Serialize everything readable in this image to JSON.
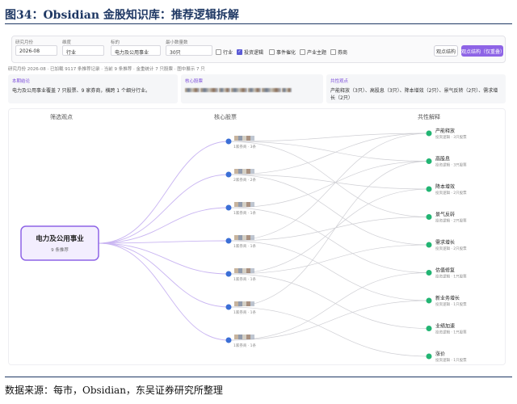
{
  "figure": {
    "title": "图34：Obsidian 金股知识库：推荐逻辑拆解",
    "source": "数据来源：每市，Obsidian，东吴证券研究所整理"
  },
  "filters": {
    "month": {
      "label": "研究月份",
      "value": "2026-08"
    },
    "dimension": {
      "label": "维度",
      "value": "行业"
    },
    "target": {
      "label": "标的",
      "value": "电力及公用事业"
    },
    "min_count": {
      "label": "最小数量数",
      "value": "30只"
    },
    "checkboxes": [
      {
        "label": "行业",
        "checked": false
      },
      {
        "label": "投资逻辑",
        "checked": true
      },
      {
        "label": "事件催化",
        "checked": false
      },
      {
        "label": "产业主题",
        "checked": false
      },
      {
        "label": "券商",
        "checked": false
      }
    ],
    "buttons": {
      "structure": "观点结构",
      "structure_grouped": "观点结构（仅重叠）"
    }
  },
  "stats_text": "研究月份 2026-08 · 已加载 9117 条推荐记录 · 当前 9 条推荐 · 金重统计 7 只股票 · 图中展示 7 只",
  "cards": {
    "conclusion": {
      "title": "本期结论",
      "body": "电力及公用事业覆盖 7 只股票、9 家券商，横跨 1 个细分行业。"
    },
    "core": {
      "title": "核心股票"
    },
    "common": {
      "title": "共性观点",
      "body": "产能释放（3只）、高股息（3只）、降本增效（2只）、景气反转（2只）、需求增长（2只）"
    }
  },
  "graph": {
    "col_headers": [
      "筛选观点",
      "核心股票",
      "共性解释"
    ],
    "root": {
      "label": "电力及公用事业",
      "sub": "9 条推荐"
    },
    "stocks": [
      {
        "sub": "1家券商 · 3条"
      },
      {
        "sub": "2家券商 · 2条"
      },
      {
        "sub": "1家券商 · 1条"
      },
      {
        "sub": "1家券商 · 1条"
      },
      {
        "sub": "1家券商 · 1条"
      },
      {
        "sub": "1家券商 · 1条"
      },
      {
        "sub": "1家券商 · 1条"
      }
    ],
    "themes": [
      {
        "name": "产能释放",
        "sub": "投资逻辑 · 3只股票"
      },
      {
        "name": "高股息",
        "sub": "投资逻辑 · 3只股票"
      },
      {
        "name": "降本增效",
        "sub": "投资逻辑 · 2只股票"
      },
      {
        "name": "景气反转",
        "sub": "投资逻辑 · 2只股票"
      },
      {
        "name": "需求增长",
        "sub": "投资逻辑 · 2只股票"
      },
      {
        "name": "估值修复",
        "sub": "投资逻辑 · 1只股票"
      },
      {
        "name": "新业务增长",
        "sub": "投资逻辑 · 1只股票"
      },
      {
        "name": "业绩加速",
        "sub": "投资逻辑 · 1只股票"
      },
      {
        "name": "涨价",
        "sub": "投资逻辑 · 1只股票"
      }
    ],
    "links": [
      [
        0,
        0
      ],
      [
        0,
        1
      ],
      [
        0,
        3
      ],
      [
        1,
        0
      ],
      [
        1,
        2
      ],
      [
        1,
        4
      ],
      [
        2,
        1
      ],
      [
        2,
        5
      ],
      [
        3,
        0
      ],
      [
        3,
        3
      ],
      [
        3,
        6
      ],
      [
        4,
        2
      ],
      [
        4,
        4
      ],
      [
        4,
        7
      ],
      [
        5,
        1
      ],
      [
        5,
        8
      ],
      [
        6,
        5
      ],
      [
        6,
        6
      ]
    ],
    "colors": {
      "root_border": "#8e64e6",
      "root_bg": "#f3eefe",
      "stock_dot": "#3b6fd6",
      "theme_dot": "#22b573",
      "root_edge": "#c9b5f2",
      "link": "#cfcfd4"
    }
  }
}
